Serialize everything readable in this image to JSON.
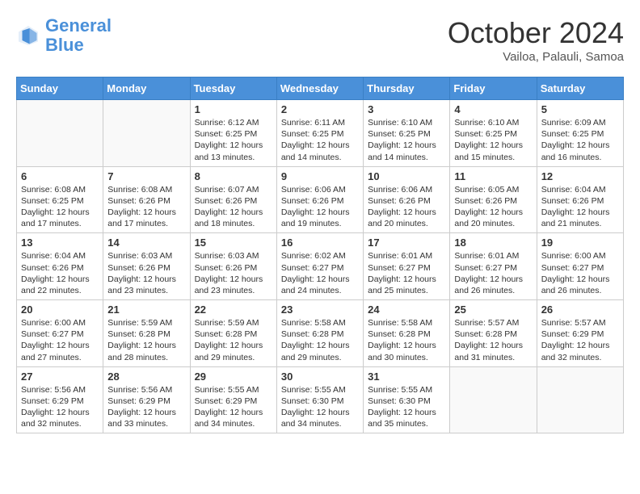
{
  "header": {
    "logo_line1": "General",
    "logo_line2": "Blue",
    "month": "October 2024",
    "location": "Vailoa, Palauli, Samoa"
  },
  "weekdays": [
    "Sunday",
    "Monday",
    "Tuesday",
    "Wednesday",
    "Thursday",
    "Friday",
    "Saturday"
  ],
  "weeks": [
    [
      {
        "day": "",
        "empty": true
      },
      {
        "day": "",
        "empty": true
      },
      {
        "day": "1",
        "sunrise": "6:12 AM",
        "sunset": "6:25 PM",
        "daylight": "12 hours and 13 minutes."
      },
      {
        "day": "2",
        "sunrise": "6:11 AM",
        "sunset": "6:25 PM",
        "daylight": "12 hours and 14 minutes."
      },
      {
        "day": "3",
        "sunrise": "6:10 AM",
        "sunset": "6:25 PM",
        "daylight": "12 hours and 14 minutes."
      },
      {
        "day": "4",
        "sunrise": "6:10 AM",
        "sunset": "6:25 PM",
        "daylight": "12 hours and 15 minutes."
      },
      {
        "day": "5",
        "sunrise": "6:09 AM",
        "sunset": "6:25 PM",
        "daylight": "12 hours and 16 minutes."
      }
    ],
    [
      {
        "day": "6",
        "sunrise": "6:08 AM",
        "sunset": "6:25 PM",
        "daylight": "12 hours and 17 minutes."
      },
      {
        "day": "7",
        "sunrise": "6:08 AM",
        "sunset": "6:26 PM",
        "daylight": "12 hours and 17 minutes."
      },
      {
        "day": "8",
        "sunrise": "6:07 AM",
        "sunset": "6:26 PM",
        "daylight": "12 hours and 18 minutes."
      },
      {
        "day": "9",
        "sunrise": "6:06 AM",
        "sunset": "6:26 PM",
        "daylight": "12 hours and 19 minutes."
      },
      {
        "day": "10",
        "sunrise": "6:06 AM",
        "sunset": "6:26 PM",
        "daylight": "12 hours and 20 minutes."
      },
      {
        "day": "11",
        "sunrise": "6:05 AM",
        "sunset": "6:26 PM",
        "daylight": "12 hours and 20 minutes."
      },
      {
        "day": "12",
        "sunrise": "6:04 AM",
        "sunset": "6:26 PM",
        "daylight": "12 hours and 21 minutes."
      }
    ],
    [
      {
        "day": "13",
        "sunrise": "6:04 AM",
        "sunset": "6:26 PM",
        "daylight": "12 hours and 22 minutes."
      },
      {
        "day": "14",
        "sunrise": "6:03 AM",
        "sunset": "6:26 PM",
        "daylight": "12 hours and 23 minutes."
      },
      {
        "day": "15",
        "sunrise": "6:03 AM",
        "sunset": "6:26 PM",
        "daylight": "12 hours and 23 minutes."
      },
      {
        "day": "16",
        "sunrise": "6:02 AM",
        "sunset": "6:27 PM",
        "daylight": "12 hours and 24 minutes."
      },
      {
        "day": "17",
        "sunrise": "6:01 AM",
        "sunset": "6:27 PM",
        "daylight": "12 hours and 25 minutes."
      },
      {
        "day": "18",
        "sunrise": "6:01 AM",
        "sunset": "6:27 PM",
        "daylight": "12 hours and 26 minutes."
      },
      {
        "day": "19",
        "sunrise": "6:00 AM",
        "sunset": "6:27 PM",
        "daylight": "12 hours and 26 minutes."
      }
    ],
    [
      {
        "day": "20",
        "sunrise": "6:00 AM",
        "sunset": "6:27 PM",
        "daylight": "12 hours and 27 minutes."
      },
      {
        "day": "21",
        "sunrise": "5:59 AM",
        "sunset": "6:28 PM",
        "daylight": "12 hours and 28 minutes."
      },
      {
        "day": "22",
        "sunrise": "5:59 AM",
        "sunset": "6:28 PM",
        "daylight": "12 hours and 29 minutes."
      },
      {
        "day": "23",
        "sunrise": "5:58 AM",
        "sunset": "6:28 PM",
        "daylight": "12 hours and 29 minutes."
      },
      {
        "day": "24",
        "sunrise": "5:58 AM",
        "sunset": "6:28 PM",
        "daylight": "12 hours and 30 minutes."
      },
      {
        "day": "25",
        "sunrise": "5:57 AM",
        "sunset": "6:28 PM",
        "daylight": "12 hours and 31 minutes."
      },
      {
        "day": "26",
        "sunrise": "5:57 AM",
        "sunset": "6:29 PM",
        "daylight": "12 hours and 32 minutes."
      }
    ],
    [
      {
        "day": "27",
        "sunrise": "5:56 AM",
        "sunset": "6:29 PM",
        "daylight": "12 hours and 32 minutes."
      },
      {
        "day": "28",
        "sunrise": "5:56 AM",
        "sunset": "6:29 PM",
        "daylight": "12 hours and 33 minutes."
      },
      {
        "day": "29",
        "sunrise": "5:55 AM",
        "sunset": "6:29 PM",
        "daylight": "12 hours and 34 minutes."
      },
      {
        "day": "30",
        "sunrise": "5:55 AM",
        "sunset": "6:30 PM",
        "daylight": "12 hours and 34 minutes."
      },
      {
        "day": "31",
        "sunrise": "5:55 AM",
        "sunset": "6:30 PM",
        "daylight": "12 hours and 35 minutes."
      },
      {
        "day": "",
        "empty": true
      },
      {
        "day": "",
        "empty": true
      }
    ]
  ]
}
